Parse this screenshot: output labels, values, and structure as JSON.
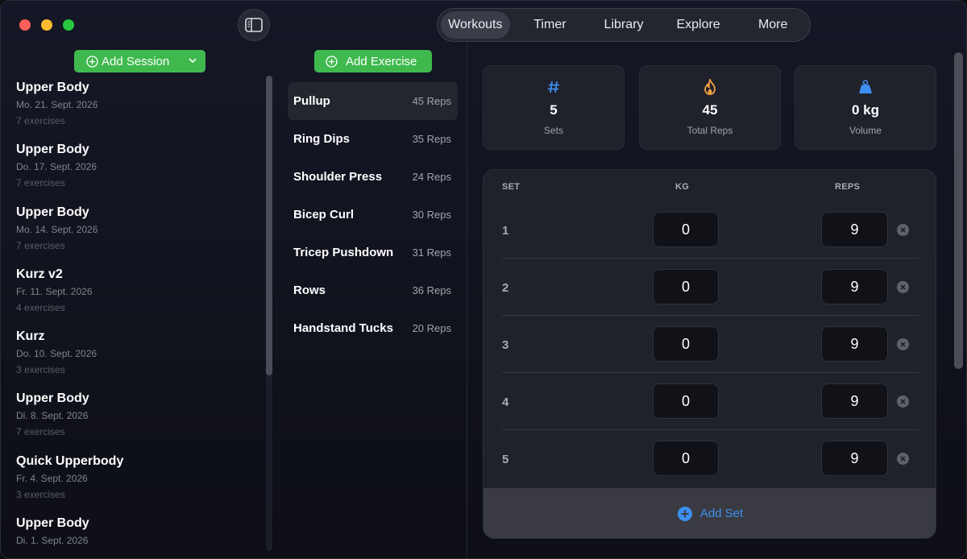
{
  "toolbar": {
    "tabs": [
      "Workouts",
      "Timer",
      "Library",
      "Explore",
      "More"
    ],
    "active_tab": "Workouts"
  },
  "sessions": {
    "add_label": "Add Session",
    "items": [
      {
        "title": "Upper Body",
        "date": "Mo. 21. Sept. 2026",
        "count": "7 exercises"
      },
      {
        "title": "Upper Body",
        "date": "Do. 17. Sept. 2026",
        "count": "7 exercises"
      },
      {
        "title": "Upper Body",
        "date": "Mo. 14. Sept. 2026",
        "count": "7 exercises"
      },
      {
        "title": "Kurz v2",
        "date": "Fr. 11. Sept. 2026",
        "count": "4 exercises"
      },
      {
        "title": "Kurz",
        "date": "Do. 10. Sept. 2026",
        "count": "3 exercises"
      },
      {
        "title": "Upper Body",
        "date": "Di. 8. Sept. 2026",
        "count": "7 exercises"
      },
      {
        "title": "Quick Upperbody",
        "date": "Fr. 4. Sept. 2026",
        "count": "3 exercises"
      },
      {
        "title": "Upper Body",
        "date": "Di. 1. Sept. 2026",
        "count": ""
      }
    ]
  },
  "exercises": {
    "add_label": "Add Exercise",
    "items": [
      {
        "name": "Pullup",
        "reps": "45 Reps"
      },
      {
        "name": "Ring Dips",
        "reps": "35 Reps"
      },
      {
        "name": "Shoulder Press",
        "reps": "24 Reps"
      },
      {
        "name": "Bicep Curl",
        "reps": "30 Reps"
      },
      {
        "name": "Tricep Pushdown",
        "reps": "31 Reps"
      },
      {
        "name": "Rows",
        "reps": "36 Reps"
      },
      {
        "name": "Handstand Tucks",
        "reps": "20 Reps"
      }
    ]
  },
  "stats": {
    "sets": {
      "value": "5",
      "label": "Sets"
    },
    "total_reps": {
      "value": "45",
      "label": "Total Reps"
    },
    "volume": {
      "value": "0 kg",
      "label": "Volume"
    }
  },
  "sets_table": {
    "headers": {
      "set": "SET",
      "kg": "KG",
      "reps": "REPS"
    },
    "rows": [
      {
        "set": "1",
        "kg": "0",
        "reps": "9"
      },
      {
        "set": "2",
        "kg": "0",
        "reps": "9"
      },
      {
        "set": "3",
        "kg": "0",
        "reps": "9"
      },
      {
        "set": "4",
        "kg": "0",
        "reps": "9"
      },
      {
        "set": "5",
        "kg": "0",
        "reps": "9"
      }
    ],
    "add_label": "Add Set"
  },
  "colors": {
    "accent_green": "#3fb94e",
    "accent_blue": "#3d8ff0",
    "fire_orange": "#f0a040"
  }
}
